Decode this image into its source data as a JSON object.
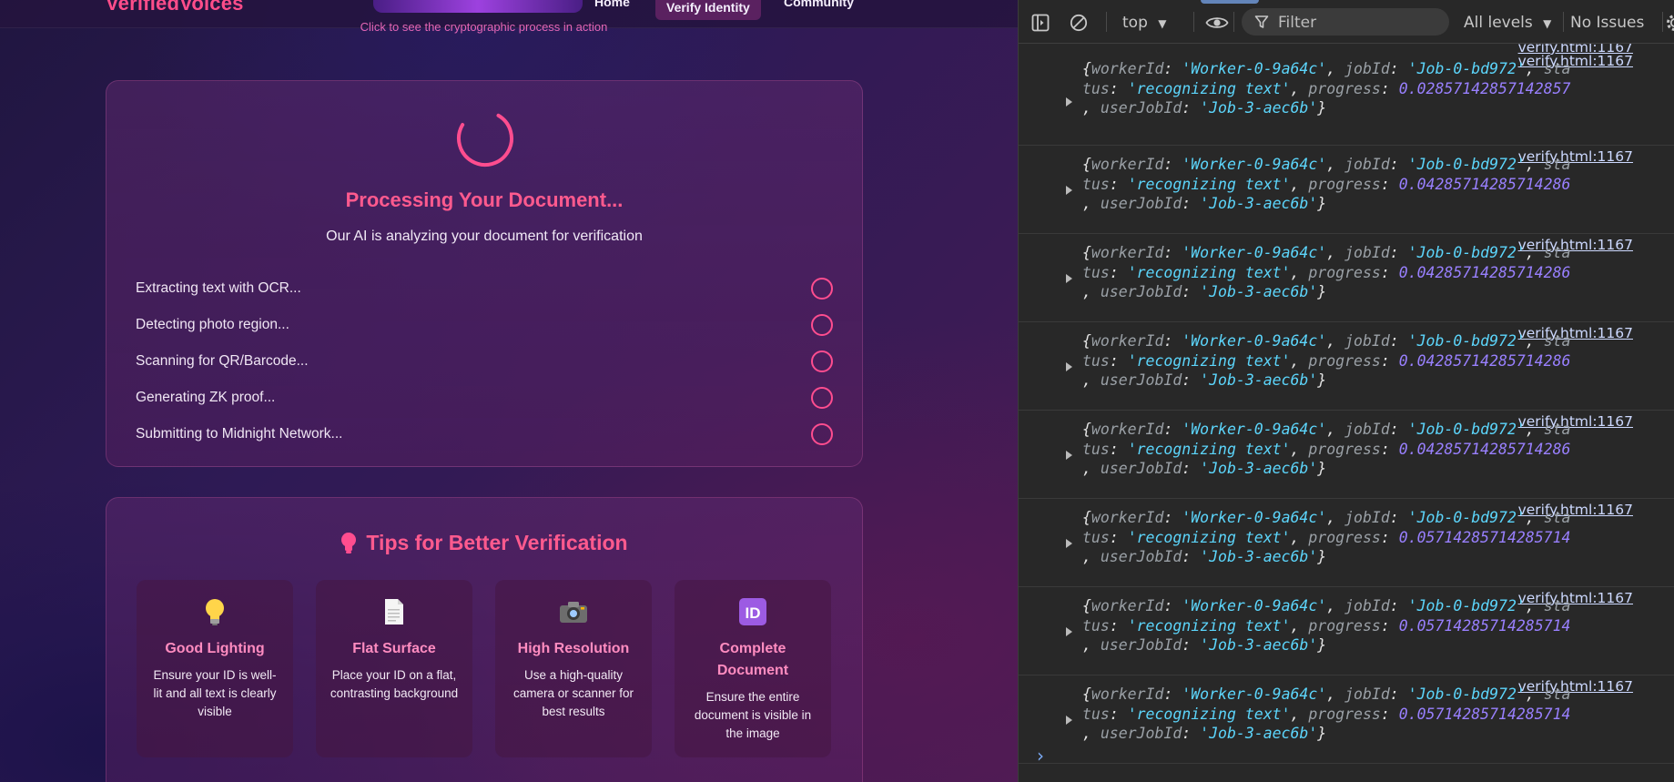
{
  "site": {
    "brand": "VerifiedVoices",
    "nav": [
      "Home",
      "Verify Identity",
      "Community"
    ],
    "demo_hint": "Click to see the cryptographic process in action"
  },
  "processing": {
    "title": "Processing Your Document...",
    "subtitle": "Our AI is analyzing your document for verification",
    "steps": [
      "Extracting text with OCR...",
      "Detecting photo region...",
      "Scanning for QR/Barcode...",
      "Generating ZK proof...",
      "Submitting to Midnight Network..."
    ]
  },
  "tips": {
    "title": "Tips for Better Verification",
    "title_icon": "lightbulb-icon",
    "items": [
      {
        "icon": "lightbulb-icon",
        "name": "Good Lighting",
        "desc": "Ensure your ID is well-lit and all text is clearly visible"
      },
      {
        "icon": "document-icon",
        "name": "Flat Surface",
        "desc": "Place your ID on a flat, contrasting background"
      },
      {
        "icon": "camera-icon",
        "name": "High Resolution",
        "desc": "Use a high-quality camera or scanner for best results"
      },
      {
        "icon": "id-icon",
        "name": "Complete Document",
        "desc": "Ensure the entire document is visible in the image"
      }
    ]
  },
  "devtools": {
    "context": "top",
    "filter_placeholder": "Filter",
    "levels": "All levels",
    "issues": "No Issues",
    "top_source": "verify.html:1167",
    "messages": [
      {
        "source": "verify.html:1167",
        "workerId": "Worker-0-9a64c",
        "jobId": "Job-0-bd972",
        "status": "recognizing text",
        "progress": "0.02857142857142857",
        "userJobId": "Job-3-aec6b"
      },
      {
        "source": "verify.html:1167",
        "workerId": "Worker-0-9a64c",
        "jobId": "Job-0-bd972",
        "status": "recognizing text",
        "progress": "0.04285714285714286",
        "userJobId": "Job-3-aec6b"
      },
      {
        "source": "verify.html:1167",
        "workerId": "Worker-0-9a64c",
        "jobId": "Job-0-bd972",
        "status": "recognizing text",
        "progress": "0.04285714285714286",
        "userJobId": "Job-3-aec6b"
      },
      {
        "source": "verify.html:1167",
        "workerId": "Worker-0-9a64c",
        "jobId": "Job-0-bd972",
        "status": "recognizing text",
        "progress": "0.04285714285714286",
        "userJobId": "Job-3-aec6b"
      },
      {
        "source": "verify.html:1167",
        "workerId": "Worker-0-9a64c",
        "jobId": "Job-0-bd972",
        "status": "recognizing text",
        "progress": "0.04285714285714286",
        "userJobId": "Job-3-aec6b"
      },
      {
        "source": "verify.html:1167",
        "workerId": "Worker-0-9a64c",
        "jobId": "Job-0-bd972",
        "status": "recognizing text",
        "progress": "0.05714285714285714",
        "userJobId": "Job-3-aec6b"
      },
      {
        "source": "verify.html:1167",
        "workerId": "Worker-0-9a64c",
        "jobId": "Job-0-bd972",
        "status": "recognizing text",
        "progress": "0.05714285714285714",
        "userJobId": "Job-3-aec6b"
      },
      {
        "source": "verify.html:1167",
        "workerId": "Worker-0-9a64c",
        "jobId": "Job-0-bd972",
        "status": "recognizing text",
        "progress": "0.05714285714285714",
        "userJobId": "Job-3-aec6b"
      }
    ]
  }
}
